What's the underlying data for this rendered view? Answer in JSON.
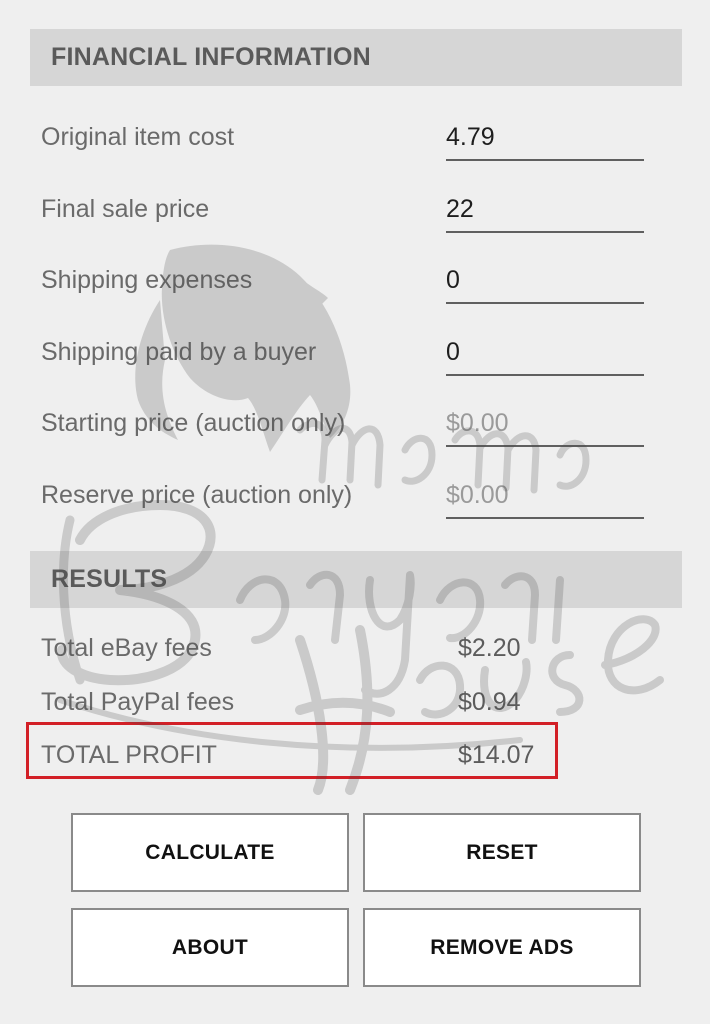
{
  "financial": {
    "header": "FINANCIAL INFORMATION",
    "fields": [
      {
        "label": "Original item cost",
        "value": "4.79",
        "placeholder": ""
      },
      {
        "label": "Final sale price",
        "value": "22",
        "placeholder": ""
      },
      {
        "label": "Shipping expenses",
        "value": "0",
        "placeholder": ""
      },
      {
        "label": "Shipping paid by a buyer",
        "value": "0",
        "placeholder": ""
      },
      {
        "label": "Starting price (auction only)",
        "value": "",
        "placeholder": "$0.00"
      },
      {
        "label": "Reserve price (auction only)",
        "value": "",
        "placeholder": "$0.00"
      }
    ]
  },
  "results": {
    "header": "RESULTS",
    "rows": [
      {
        "label": "Total eBay fees",
        "value": "$2.20"
      },
      {
        "label": "Total PayPal fees",
        "value": "$0.94"
      },
      {
        "label": "TOTAL PROFIT",
        "value": "$14.07"
      }
    ]
  },
  "buttons": {
    "calculate": "CALCULATE",
    "reset": "RESET",
    "about": "ABOUT",
    "remove_ads": "REMOVE ADS"
  },
  "watermark": {
    "line1": "mama",
    "line2": "Baryani",
    "line3": "House"
  },
  "colors": {
    "background": "#efefef",
    "header_bg": "#d6d6d6",
    "highlight_border": "#d21f26"
  }
}
